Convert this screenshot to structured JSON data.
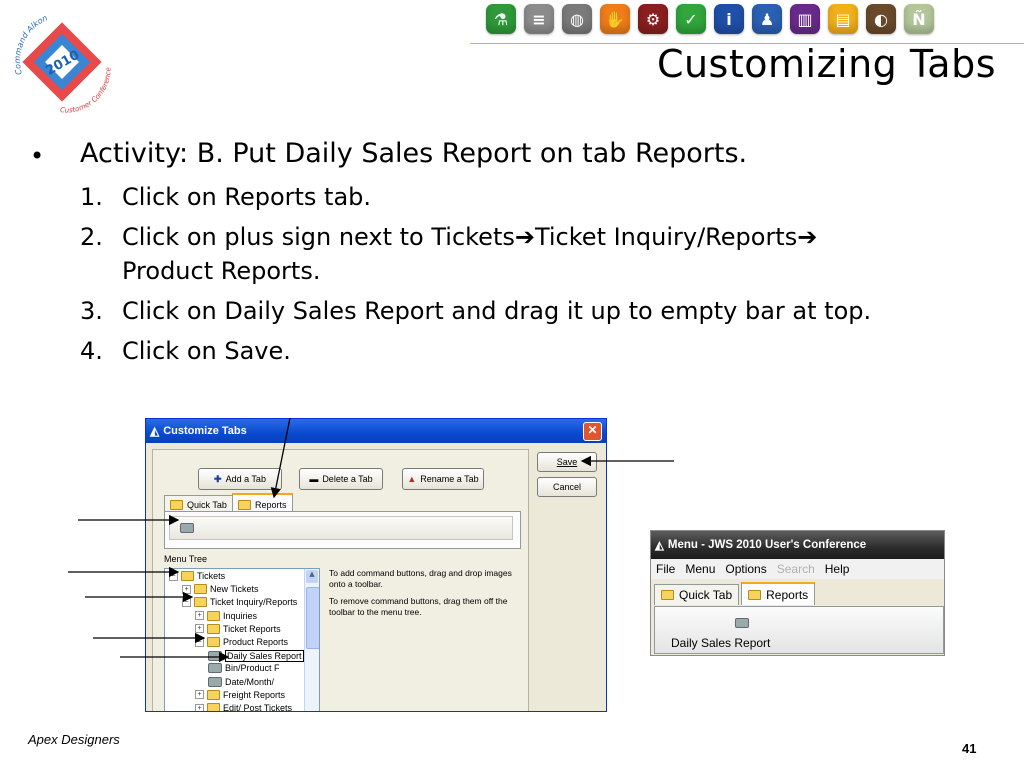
{
  "slide": {
    "title": "Customizing Tabs",
    "bullet": "Activity:  B.  Put Daily Sales Report on tab Reports.",
    "steps": [
      {
        "num": "1.",
        "text": "Click on Reports tab."
      },
      {
        "num": "2.",
        "text_a": "Click on plus sign next to Tickets",
        "text_b": "Ticket Inquiry/Reports",
        "text_c": "Product Reports."
      },
      {
        "num": "3.",
        "text": "Click on Daily Sales Report and drag it up to empty bar at top."
      },
      {
        "num": "4.",
        "text": "Click on Save."
      }
    ],
    "arrow_glyph": "➔",
    "footer": "Apex Designers",
    "page_number": "41"
  },
  "logo": {
    "year": "2010",
    "top_text": "Command Alkon",
    "bottom_text": "Customer Conference"
  },
  "toolbar_icons": [
    {
      "name": "lab-flask-icon",
      "color": "#2e9a3a",
      "glyph": "⚗"
    },
    {
      "name": "stack-icon",
      "color": "#8c8c8c",
      "glyph": "≡"
    },
    {
      "name": "globe-icon",
      "color": "#7a7a7a",
      "glyph": "◍"
    },
    {
      "name": "hand-icon",
      "color": "#ef7d1a",
      "glyph": "✋"
    },
    {
      "name": "gears-icon",
      "color": "#8a1f1f",
      "glyph": "⚙"
    },
    {
      "name": "check-icon",
      "color": "#30a63c",
      "glyph": "✓"
    },
    {
      "name": "info-icon",
      "color": "#1f4fa8",
      "glyph": "i"
    },
    {
      "name": "person-desk-icon",
      "color": "#2a5fb2",
      "glyph": "♟"
    },
    {
      "name": "panel-icon",
      "color": "#6a2a8c",
      "glyph": "▥"
    },
    {
      "name": "folder-icon",
      "color": "#f2b01b",
      "glyph": "▤"
    },
    {
      "name": "truck-icon",
      "color": "#6a4a2a",
      "glyph": "◐"
    },
    {
      "name": "n-icon",
      "color": "#b3c79a",
      "glyph": "Ñ"
    }
  ],
  "dialog": {
    "title": "Customize Tabs",
    "close_glyph": "✕",
    "buttons": {
      "add_tab": "Add a Tab",
      "delete_tab": "Delete a Tab",
      "rename_tab": "Rename a Tab",
      "save": "Save",
      "cancel": "Cancel"
    },
    "tabs": [
      "Quick Tab",
      "Reports"
    ],
    "menu_tree_label": "Menu Tree",
    "tree": [
      {
        "label": "Tickets",
        "pm": "−",
        "indent": 0
      },
      {
        "label": "New Tickets",
        "pm": "+",
        "indent": 1
      },
      {
        "label": "Ticket Inquiry/Reports",
        "pm": "−",
        "indent": 1
      },
      {
        "label": "Inquiries",
        "pm": "+",
        "indent": 2
      },
      {
        "label": "Ticket Reports",
        "pm": "+",
        "indent": 2
      },
      {
        "label": "Product Reports",
        "pm": "−",
        "indent": 2
      },
      {
        "label": "Daily Sales Report",
        "pm": "",
        "indent": 3
      },
      {
        "label": "Bin/Product F",
        "pm": "",
        "indent": 3
      },
      {
        "label": "Date/Month/",
        "pm": "",
        "indent": 3
      },
      {
        "label": "Freight Reports",
        "pm": "+",
        "indent": 2
      },
      {
        "label": "Edit/ Post Tickets",
        "pm": "+",
        "indent": 2
      }
    ],
    "hint1": "To add command buttons, drag and drop images onto a toolbar.",
    "hint2": "To remove command buttons, drag them off the toolbar to the menu tree."
  },
  "menu_window": {
    "title": "Menu - JWS 2010 User's Conference",
    "menu_items": [
      "File",
      "Menu",
      "Options",
      "Search",
      "Help"
    ],
    "tabs": [
      "Quick Tab",
      "Reports"
    ],
    "toolbar_button": "Daily Sales Report"
  }
}
